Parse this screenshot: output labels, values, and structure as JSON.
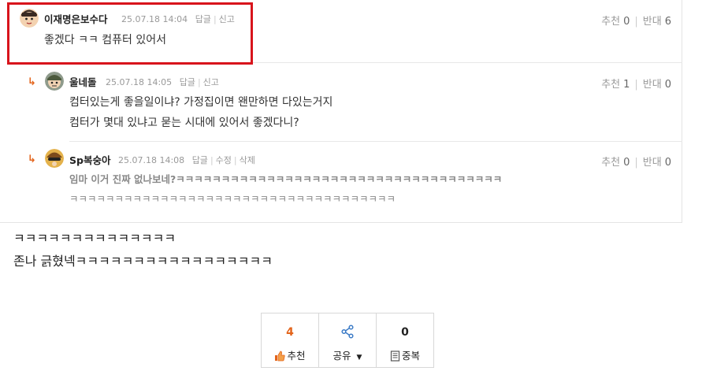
{
  "comments": [
    {
      "nick": "이재명은보수다",
      "date": "25.07.18 14:04",
      "actions": [
        "답글",
        "신고"
      ],
      "up_label": "추천",
      "up": "0",
      "down_label": "반대",
      "down": "6",
      "lines": [
        "좋겠다 ㅋㅋ 컴퓨터 있어서"
      ]
    },
    {
      "nick": "울네돌",
      "date": "25.07.18 14:05",
      "actions": [
        "답글",
        "신고"
      ],
      "up_label": "추천",
      "up": "1",
      "down_label": "반대",
      "down": "0",
      "lines": [
        "컴터있는게 좋을일이냐? 가정집이면 왠만하면 다있는거지",
        "컴터가 몇대 있냐고 묻는 시대에 있어서 좋겠다니?"
      ]
    },
    {
      "nick": "Sp복숭아",
      "date": "25.07.18 14:08",
      "actions": [
        "답글",
        "수정",
        "삭제"
      ],
      "up_label": "추천",
      "up": "0",
      "down_label": "반대",
      "down": "0",
      "lines": [
        "임마 이거 진짜 없나보네?ㅋㅋㅋㅋㅋㅋㅋㅋㅋㅋㅋㅋㅋㅋㅋㅋㅋㅋㅋㅋㅋㅋㅋㅋㅋㅋㅋㅋㅋㅋㅋㅋㅋㅋㅋㅋ",
        "ㅋㅋㅋㅋㅋㅋㅋㅋㅋㅋㅋㅋㅋㅋㅋㅋㅋㅋㅋㅋㅋㅋㅋㅋㅋㅋㅋㅋㅋㅋㅋㅋㅋㅋㅋㅋ"
      ]
    }
  ],
  "post": {
    "line1": "ㅋㅋㅋㅋㅋㅋㅋㅋㅋㅋㅋㅋㅋㅋ",
    "line2": "존나 긁혔넥ㅋㅋㅋㅋㅋㅋㅋㅋㅋㅋㅋㅋㅋㅋㅋㅋㅋ"
  },
  "buttons": {
    "recommend_count": "4",
    "recommend_label": "추천",
    "share_label": "공유",
    "duplicate_count": "0",
    "duplicate_label": "중복"
  },
  "colors": {
    "accent": "#e3641b",
    "highlight_border": "#d8141c"
  },
  "icons": {
    "reply": "reply-arrow-icon",
    "recommend": "thumbs-up-icon",
    "share": "share-icon",
    "duplicate": "document-icon",
    "dropdown": "caret-down-icon"
  }
}
